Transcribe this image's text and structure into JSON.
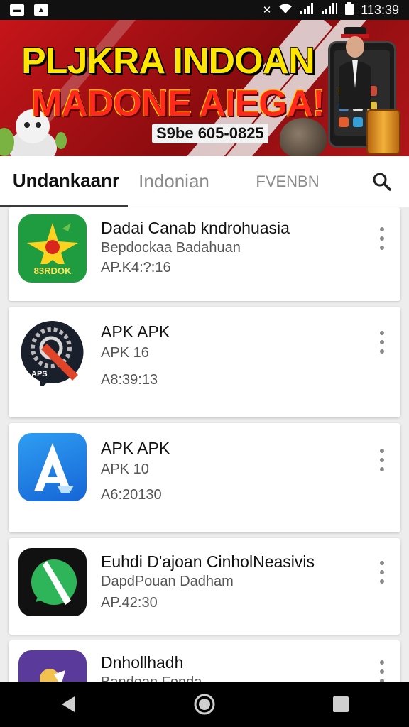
{
  "status_bar": {
    "time": "113:39",
    "icons": [
      "notification-icon",
      "image-icon",
      "bluetooth-icon",
      "wifi-icon",
      "signal-icon",
      "signal-icon",
      "battery-icon"
    ]
  },
  "banner": {
    "line1": "PLJKRA INDOAN",
    "line2": "MADONE AIEGA!",
    "phone_text": "S9be 605-0825"
  },
  "tabs": [
    {
      "label": "Undankaanr",
      "active": true
    },
    {
      "label": "Indonian",
      "active": false
    },
    {
      "label": "FVENBN",
      "active": false
    }
  ],
  "apps": [
    {
      "name": "Dadai Canab kndrohuasia",
      "developer": "Bepdockaa Badahuan",
      "meta": "AP.K4:?:16",
      "icon": "star-app-icon"
    },
    {
      "name": "APK APK",
      "developer": "APK 16",
      "meta": "A8:39:13",
      "icon": "apk-tool-icon"
    },
    {
      "name": "APK APK",
      "developer": "APK 10",
      "meta": "A6:20130",
      "icon": "app-store-icon"
    },
    {
      "name": "Euhdi D'ajoan CinholNeasivis",
      "developer": "DapdPouan Dadham",
      "meta": "AP.42:30",
      "icon": "chat-app-icon"
    },
    {
      "name": "Dnhollhadh",
      "developer": "Bandoan Fonda",
      "meta": "",
      "icon": "purple-app-icon"
    }
  ],
  "colors": {
    "banner_red": "#c5151a",
    "banner_yellow": "#ffe600",
    "tab_active": "#111111",
    "icon_green": "#1f9c3f",
    "icon_blue": "#1e7be0"
  }
}
